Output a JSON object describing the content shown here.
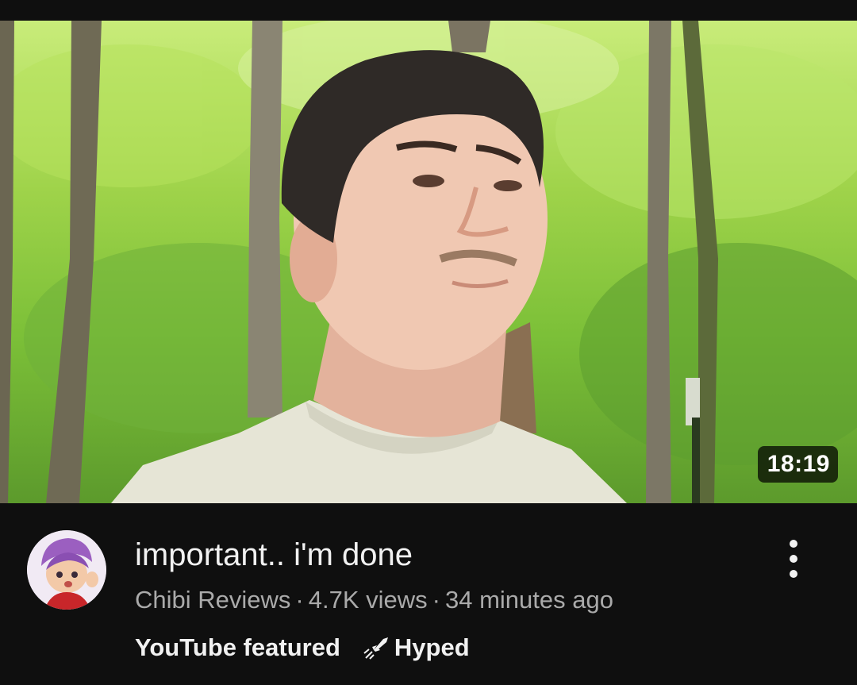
{
  "video": {
    "duration": "18:19",
    "title": "important.. i'm done",
    "channel": "Chibi Reviews",
    "views": "4.7K views",
    "age": "34 minutes ago",
    "separator": "·",
    "badge_featured": "YouTube featured",
    "badge_hyped": "Hyped"
  },
  "icons": {
    "more": "more-vert-icon",
    "hyped": "hyped-rocket-icon"
  },
  "colors": {
    "background": "#0f0f0f",
    "title": "#f1f1f1",
    "secondary": "#aaaaaa"
  }
}
